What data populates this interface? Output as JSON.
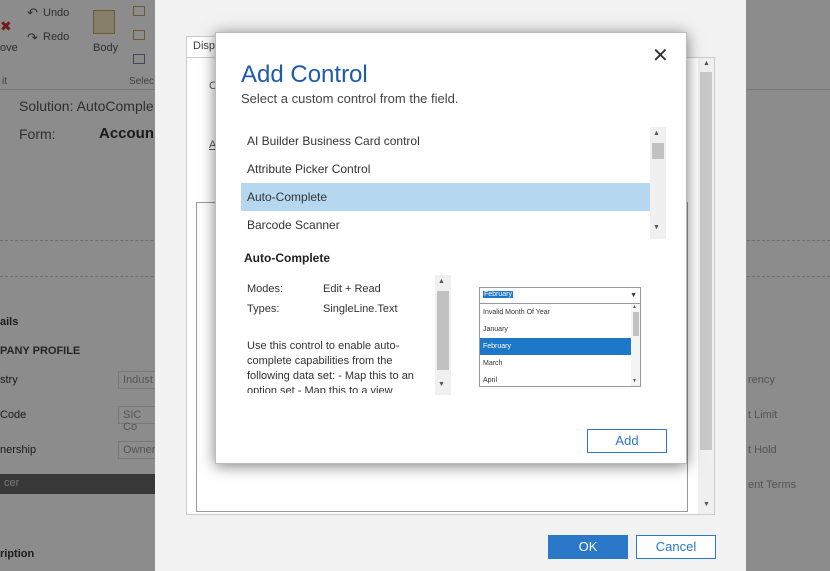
{
  "ribbon": {
    "undo_label": "Undo",
    "redo_label": "Redo",
    "remove_label": "ove",
    "body_label": "Body",
    "edit_group": "it",
    "select_group": "Selec"
  },
  "solution": {
    "solution_label": "Solution: AutoComple",
    "form_label": "Form:",
    "form_name": "Accoun"
  },
  "form": {
    "details_label": "ails",
    "company_profile_label": "PANY PROFILE",
    "industry_label": "stry",
    "industry_placeholder": "Indust",
    "sic_label": "Code",
    "sic_placeholder": "SIC Co",
    "ownership_label": "nership",
    "ownership_placeholder": "Owner",
    "officer_label": "cer",
    "description_label": "ription",
    "currency_label": "rency",
    "limit_label": "t Limit",
    "hold_label": "t Hold",
    "terms_label": "ent Terms"
  },
  "panel": {
    "tab_label": "Disp",
    "side_label_c": "C",
    "side_label_a": "A",
    "ok_label": "OK",
    "cancel_label": "Cancel"
  },
  "dialog": {
    "title": "Add Control",
    "subtitle": "Select a custom control from the field.",
    "close_icon": "✕",
    "controls": [
      {
        "label": "AI Builder Business Card control"
      },
      {
        "label": "Attribute Picker Control"
      },
      {
        "label": "Auto-Complete"
      },
      {
        "label": "Barcode Scanner"
      }
    ],
    "selected_control": "Auto-Complete",
    "details": {
      "title": "Auto-Complete",
      "modes_label": "Modes:",
      "modes_value": "Edit + Read",
      "types_label": "Types:",
      "types_value": "SingleLine.Text",
      "description": "Use this control to enable auto-complete capabilities from the following data set: - Map this to an option set - Map this to a view"
    },
    "preview": {
      "selected_value": "February",
      "options": [
        {
          "label": "Invalid Month Of Year"
        },
        {
          "label": "January"
        },
        {
          "label": "February"
        },
        {
          "label": "March"
        },
        {
          "label": "April"
        }
      ],
      "selected_option": "February"
    },
    "add_label": "Add"
  },
  "colors": {
    "accent": "#2b78c8",
    "title_blue": "#1e5ba8",
    "selected_row": "#b6d7f0",
    "overlay": "#000000"
  }
}
